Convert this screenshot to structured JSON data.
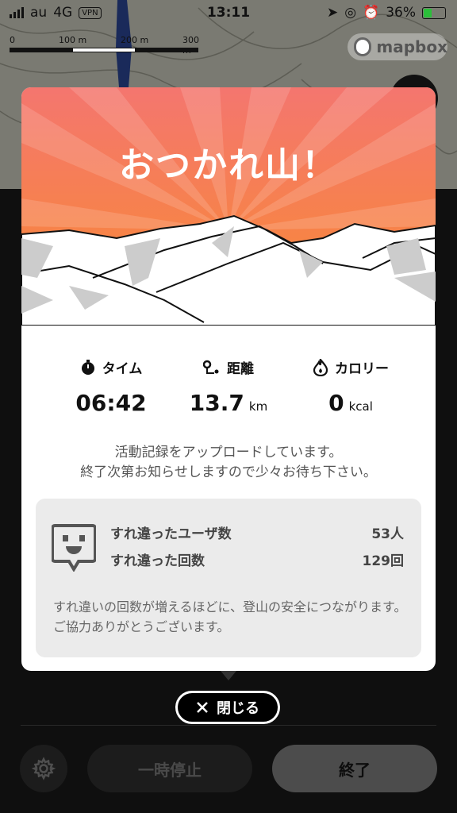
{
  "status_bar": {
    "carrier": "au",
    "network": "4G",
    "vpn": "VPN",
    "time": "13:11",
    "battery": "36%"
  },
  "map": {
    "scale_labels": [
      "0",
      "100 m",
      "200 m",
      "300 m"
    ],
    "attribution": "mapbox"
  },
  "card": {
    "title": "おつかれ山！",
    "stats": [
      {
        "label": "タイム",
        "icon": "stopwatch-icon",
        "value": "06:42",
        "unit": ""
      },
      {
        "label": "距離",
        "icon": "route-icon",
        "value": "13.7",
        "unit": "km"
      },
      {
        "label": "カロリー",
        "icon": "flame-icon",
        "value": "0",
        "unit": "kcal"
      }
    ],
    "message_line1": "活動記録をアップロードしています。",
    "message_line2": "終了次第お知らせしますので少々お待ち下さい。",
    "pass": {
      "users_label": "すれ違ったユーザ数",
      "users_value": "53人",
      "count_label": "すれ違った回数",
      "count_value": "129回",
      "note": "すれ違いの回数が増えるほどに、登山の安全につながります。ご協力ありがとうございます。"
    }
  },
  "controls": {
    "close_label": "閉じる",
    "pause_label": "一時停止",
    "end_label": "終了"
  },
  "colors": {
    "hero_top": "#f47a6f",
    "hero_bottom": "#f98a33",
    "panel": "#0f0f0f"
  }
}
